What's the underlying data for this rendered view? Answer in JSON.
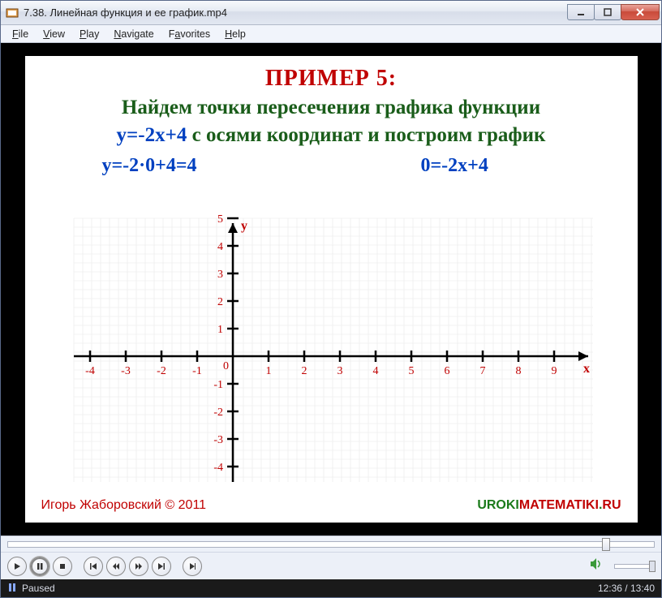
{
  "window": {
    "title": "7.38. Линейная функция и ее график.mp4"
  },
  "menu": {
    "file": "File",
    "view": "View",
    "play": "Play",
    "navigate": "Navigate",
    "favorites": "Favorites",
    "help": "Help"
  },
  "slide": {
    "heading": "ПРИМЕР 5:",
    "line2": "Найдем точки пересечения графика функции",
    "line3_eq": "y=-2x+4",
    "line3_rest": " с осями координат и построим график",
    "calc_left": "y=-2·0+4=4",
    "calc_right": "0=-2x+4",
    "author": "Игорь Жаборовский © 2011",
    "brand_g": "UROKI",
    "brand_r1": "MATEMATIKI",
    "brand_dot": ".",
    "brand_r2": "RU",
    "y_label": "y",
    "x_label": "x",
    "origin": "0"
  },
  "chart_data": {
    "type": "line",
    "title": "",
    "xlabel": "x",
    "ylabel": "y",
    "xlim": [
      -4,
      9
    ],
    "ylim": [
      -4,
      5
    ],
    "x_ticks": [
      -4,
      -3,
      -2,
      -1,
      1,
      2,
      3,
      4,
      5,
      6,
      7,
      8,
      9
    ],
    "y_ticks": [
      -4,
      -3,
      -2,
      -1,
      1,
      2,
      3,
      4,
      5
    ],
    "series": []
  },
  "playback": {
    "status": "Paused",
    "time": "12:36 / 13:40",
    "progress_pct": 92
  }
}
